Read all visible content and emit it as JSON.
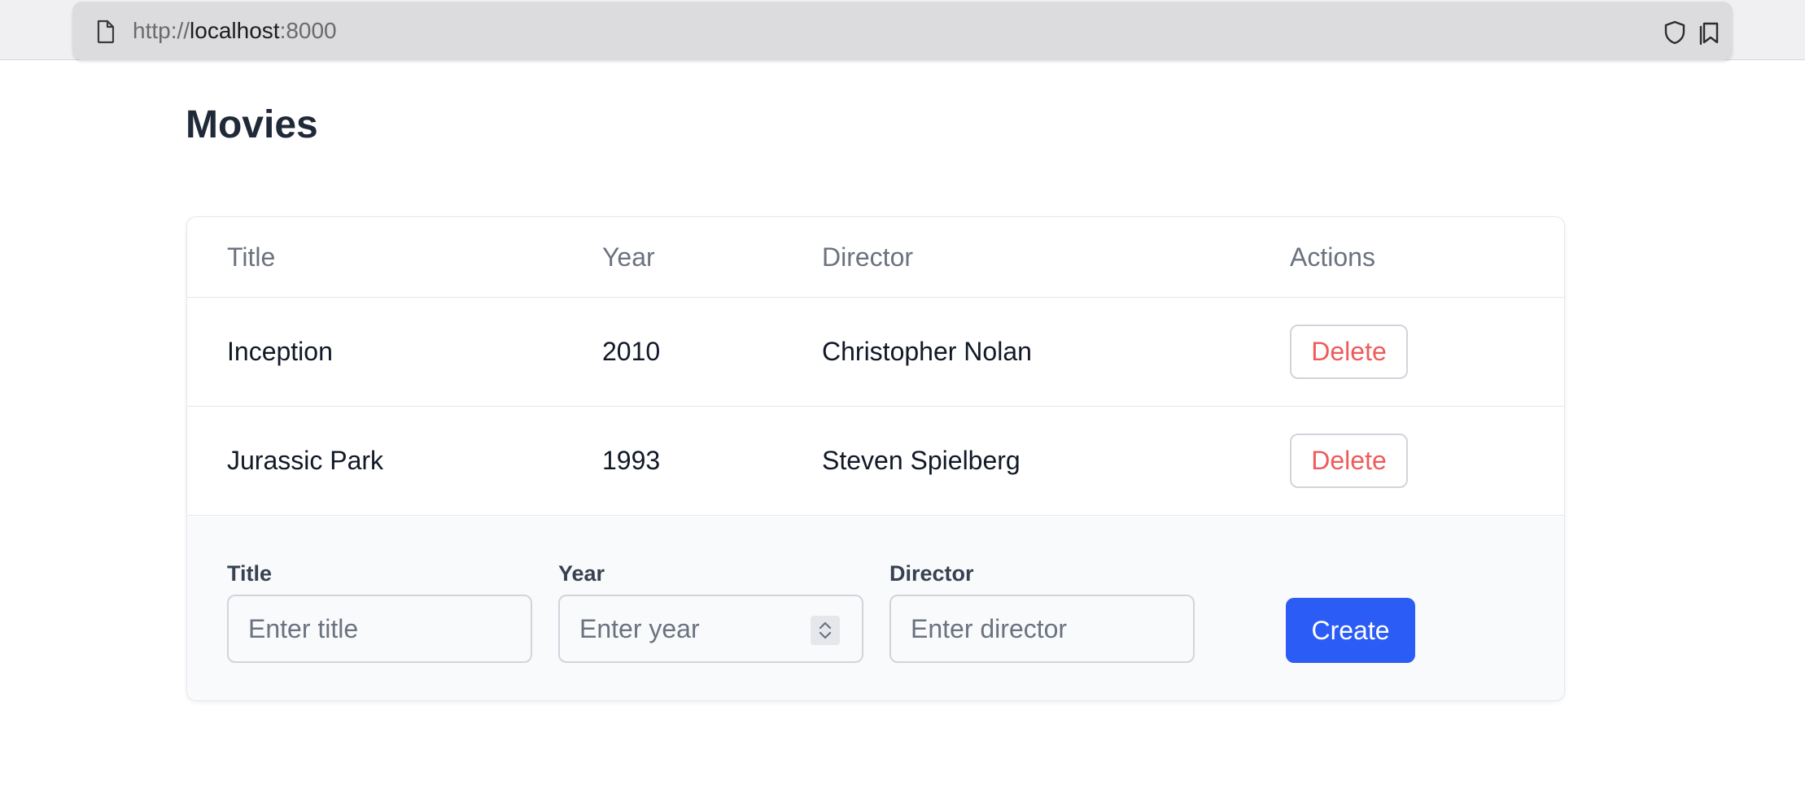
{
  "browser": {
    "url_scheme": "http://",
    "url_host": "localhost",
    "url_port": ":8000",
    "icons": [
      "page-icon",
      "shield-icon",
      "reader-view-icon"
    ]
  },
  "page": {
    "title": "Movies"
  },
  "table": {
    "columns": [
      "Title",
      "Year",
      "Director",
      "Actions"
    ],
    "rows": [
      {
        "title": "Inception",
        "year": "2010",
        "director": "Christopher Nolan",
        "action_label": "Delete"
      },
      {
        "title": "Jurassic Park",
        "year": "1993",
        "director": "Steven Spielberg",
        "action_label": "Delete"
      }
    ]
  },
  "form": {
    "title_label": "Title",
    "title_placeholder": "Enter title",
    "title_value": "",
    "year_label": "Year",
    "year_placeholder": "Enter year",
    "year_value": "",
    "director_label": "Director",
    "director_placeholder": "Enter director",
    "director_value": "",
    "submit_label": "Create"
  },
  "colors": {
    "primary": "#2b5cf6",
    "danger_text": "#ef5b5b",
    "heading": "#1f2937",
    "muted": "#6b7280",
    "border": "#e5e7eb"
  }
}
